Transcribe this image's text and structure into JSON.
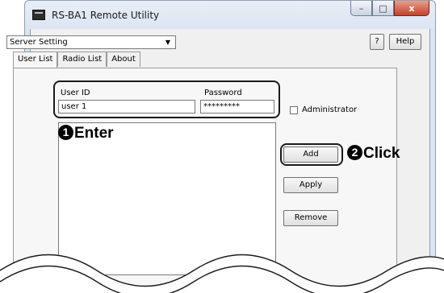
{
  "window": {
    "title": "RS-BA1 Remote Utility"
  },
  "titlebar_buttons": {
    "minimize": "–",
    "maximize": "□",
    "close": "x"
  },
  "toolbar": {
    "mode_select_value": "Server Setting",
    "question_label": "?",
    "help_label": "Help"
  },
  "tabs": [
    {
      "label": "User List",
      "active": true
    },
    {
      "label": "Radio List",
      "active": false
    },
    {
      "label": "About",
      "active": false
    }
  ],
  "form": {
    "user_id_label": "User ID",
    "user_id_value": "user 1",
    "password_label": "Password",
    "password_value": "*********",
    "administrator_label": "Administrator",
    "administrator_checked": false
  },
  "buttons": {
    "add": "Add",
    "apply": "Apply",
    "remove": "Remove"
  },
  "callouts": {
    "enter_num": "1",
    "enter_text": "Enter",
    "click_num": "2",
    "click_text": "Click"
  },
  "icons": [
    "app-icon",
    "dropdown-arrow-icon"
  ],
  "colors": {
    "close_button": "#c5412b",
    "titlebar": "#dbe5f2",
    "highlight_border": "#1a1a1a"
  }
}
